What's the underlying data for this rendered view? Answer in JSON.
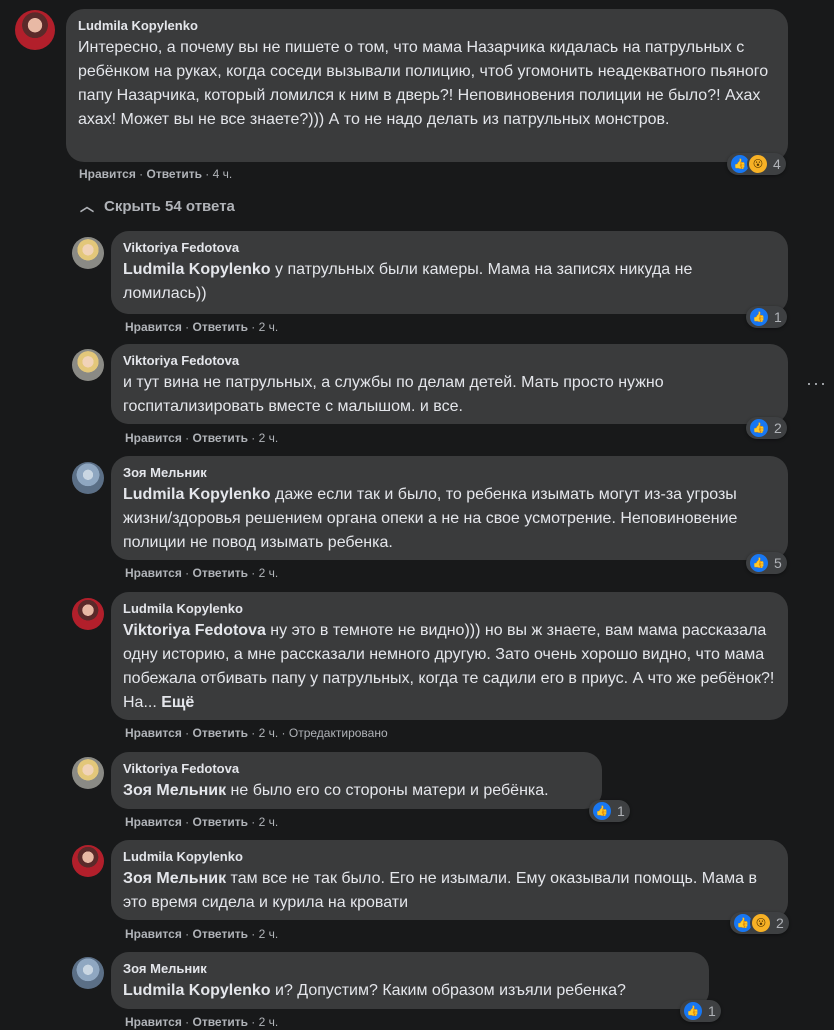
{
  "top_comment": {
    "author": "Ludmila Kopylenko",
    "text": "Интересно, а почему вы не пишете о том, что мама Назарчика кидалась на патрульных с ребёнком на руках, когда соседи вызывали полицию, чтоб угомонить неадекватного пьяного папу Назарчика, который ломился к ним в дверь?! Неповиновения полиции не было?! Ахах ахах! Может вы не все знаете?))) А то не надо делать из патрульных монстров.",
    "like_label": "Нравится",
    "reply_label": "Ответить",
    "time": "4 ч.",
    "reaction_count": "4"
  },
  "hide_replies": "Скрыть 54 ответа",
  "more_icon": "more-dots-icon",
  "replies": [
    {
      "author": "Viktoriya Fedotova",
      "mention": "Ludmila Kopylenko",
      "text": " у патрульных были камеры. Мама на записях никуда не ломилась))",
      "like_label": "Нравится",
      "reply_label": "Ответить",
      "time": "2 ч.",
      "reaction_count": "1"
    },
    {
      "author": "Viktoriya Fedotova",
      "mention": "",
      "text": "и тут вина не патрульных, а службы по делам детей. Мать просто нужно госпитализировать вместе с малышом. и все.",
      "like_label": "Нравится",
      "reply_label": "Ответить",
      "time": "2 ч.",
      "reaction_count": "2"
    },
    {
      "author": "Зоя Мельник",
      "mention": "Ludmila Kopylenko",
      "text": " даже если так и было, то ребенка изымать могут из-за угрозы жизни/здоровья решением органа опеки а не на свое усмотрение. Неповиновение полиции не повод изымать ребенка.",
      "like_label": "Нравится",
      "reply_label": "Ответить",
      "time": "2 ч.",
      "reaction_count": "5"
    },
    {
      "author": "Ludmila Kopylenko",
      "mention": "Viktoriya Fedotova",
      "text": " ну это в темноте не видно))) но вы ж знаете, вам мама рассказала одну историю, а мне рассказали немного другую. Зато очень хорошо видно, что мама побежала отбивать папу у патрульных, когда те садили его в приус. А что же ребёнок?! На...",
      "more": "Ещё",
      "like_label": "Нравится",
      "reply_label": "Ответить",
      "time": "2 ч.",
      "edited": "Отредактировано"
    },
    {
      "author": "Viktoriya Fedotova",
      "mention": "Зоя Мельник",
      "text": " не было его со стороны матери и ребёнка.",
      "like_label": "Нравится",
      "reply_label": "Ответить",
      "time": "2 ч.",
      "reaction_count": "1"
    },
    {
      "author": "Ludmila Kopylenko",
      "mention": "Зоя Мельник",
      "text": " там все не так было. Его не изымали. Ему оказывали помощь. Мама в это время сидела и курила на кровати",
      "like_label": "Нравится",
      "reply_label": "Ответить",
      "time": "2 ч.",
      "reaction_count": "2"
    },
    {
      "author": "Зоя Мельник",
      "mention": "Ludmila Kopylenko",
      "text": " и? Допустим? Каким образом изъяли ребенка?",
      "like_label": "Нравится",
      "reply_label": "Ответить",
      "time": "2 ч.",
      "reaction_count": "1"
    }
  ]
}
